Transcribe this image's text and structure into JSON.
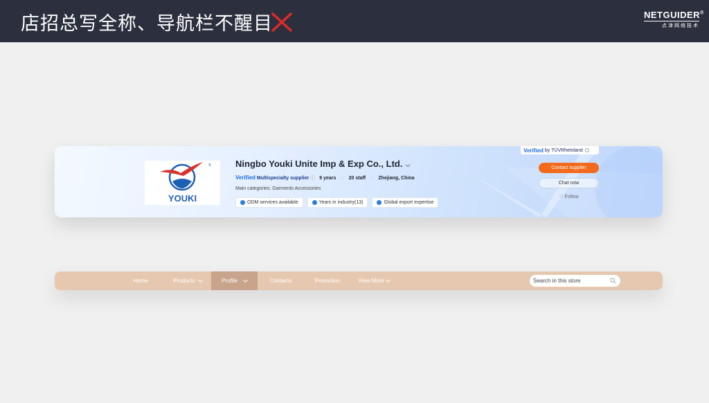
{
  "header": {
    "title": "店招总写全称、导航栏不醒目",
    "verdict_icon": "x-icon",
    "brand": {
      "name": "NETGUIDER",
      "reg": "®",
      "subtitle": "点津网络技术"
    }
  },
  "store": {
    "logo_text": "YOUKI",
    "company_name": "Ningbo Youki Unite Imp & Exp Co., Ltd.",
    "verified": "Verified",
    "supplier_type": "Multispecialty supplier",
    "years": "9 years",
    "staff": "20 staff",
    "location": "Zhejiang, China",
    "categories": "Main categories: Garments Accessories",
    "tags": [
      "ODM services available",
      "Years in industry(13)",
      "Global export expertise"
    ],
    "tuv_verified": "Verified",
    "tuv_by": "by TÜVRheinland",
    "contact_label": "Contact supplier",
    "chat_label": "Chat now",
    "follow_label": "Follow"
  },
  "nav": {
    "items": [
      {
        "label": "Home"
      },
      {
        "label": "Products"
      },
      {
        "label": "Profile"
      },
      {
        "label": "Contacts"
      },
      {
        "label": "Promotion"
      },
      {
        "label": "View More"
      }
    ],
    "active": "Profile",
    "search_placeholder": "Search in this store"
  },
  "colors": {
    "header_bg": "#2c2f3d",
    "cross": "#e02a2a",
    "contact_button": "#f26a1b",
    "navbar_bg": "#e6c8b0",
    "navbar_active": "#c7a48b",
    "verified_blue": "#1d6fe0"
  }
}
